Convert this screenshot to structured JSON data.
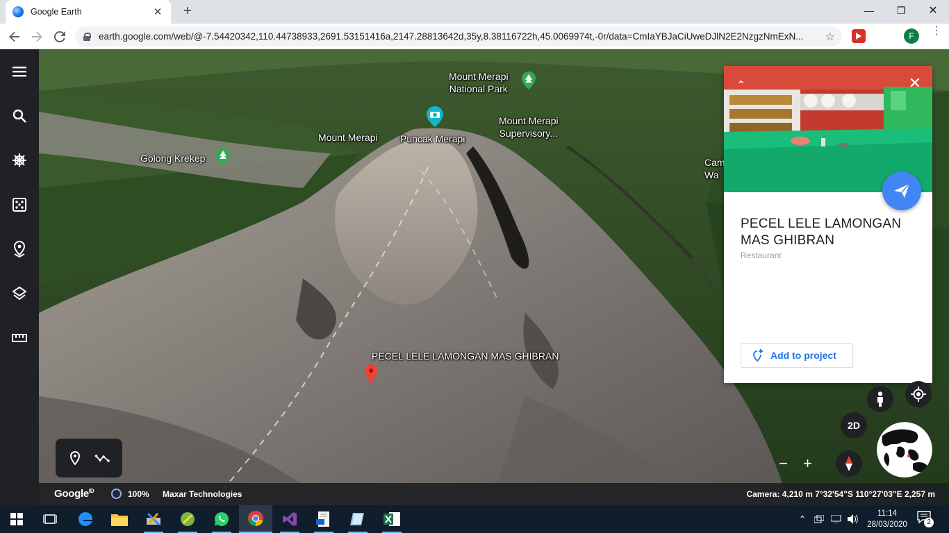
{
  "browser": {
    "tab_title": "Google Earth",
    "tab_close": "✕",
    "new_tab": "+",
    "url": "earth.google.com/web/@-7.54420342,110.44738933,2691.53151416a,2147.28813642d,35y,8.38116722h,45.0069974t,-0r/data=CmIaYBJaCiUweDJlN2E2NzgzNmExN...",
    "profile_initial": "F",
    "window": {
      "minimize": "—",
      "restore": "❐",
      "close": "✕"
    }
  },
  "map": {
    "labels": {
      "national_park": "Mount Merapi\nNational Park",
      "mount_merapi": "Mount Merapi",
      "puncak": "Puncak Merapi",
      "supervisory": "Mount Merapi\nSupervisory...",
      "golong": "Golong Krekep",
      "partial_right": "Cam\nWa",
      "restaurant_marker": "PECEL LELE LAMONGAN MAS GHIBRAN"
    }
  },
  "card": {
    "title": "PECEL LELE LAMONGAN MAS GHIBRAN",
    "subtitle": "Restaurant",
    "add_to_project": "Add to project",
    "collapse": "⌃",
    "close": "✕"
  },
  "controls": {
    "view_2d": "2D",
    "zoom_out": "−",
    "zoom_in": "+"
  },
  "status": {
    "brand": "Google",
    "brand_suffix": "ID",
    "load_percent": "100%",
    "attribution": "Maxar Technologies",
    "camera": "Camera: 4,210 m   7°32'54\"S 110°27'03\"E   2,257 m"
  },
  "taskbar": {
    "time": "11:14",
    "date": "28/03/2020",
    "notification_count": "2"
  },
  "colors": {
    "accent_blue": "#4285f4",
    "link_blue": "#1a73e8",
    "sidebar": "#202124",
    "taskbar": "#0f1d2c"
  }
}
